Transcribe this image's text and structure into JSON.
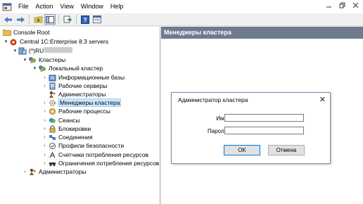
{
  "menu": {
    "items": [
      "File",
      "Action",
      "View",
      "Window",
      "Help"
    ],
    "window_controls": [
      "minimize-icon",
      "restore-icon",
      "close-icon"
    ]
  },
  "toolbar": {
    "buttons": [
      "back-arrow-icon",
      "forward-arrow-icon",
      "up-folder-icon",
      "show-hide-tree-icon",
      "export-list-icon",
      "help-icon",
      "properties-icon"
    ]
  },
  "tree": {
    "root": "Console Root",
    "server": "Central 1C:Enterprise 8.3 servers",
    "host": "(*)RU",
    "clusters": "Кластеры",
    "local_cluster": "Локальный кластер",
    "items": [
      "Информационные базы",
      "Рабочие серверы",
      "Администраторы",
      "Менеджеры кластера",
      "Рабочие процессы",
      "Сеансы",
      "Блокировки",
      "Соединения",
      "Профили безопасности",
      "Счетчики потребления ресурсов",
      "Ограничения потребления ресурсов"
    ],
    "admins": "Администраторы"
  },
  "right_pane": {
    "header": "Менеджеры кластера"
  },
  "dialog": {
    "title": "Администратор кластера",
    "name_label": "Имя:",
    "name_value": "",
    "password_label": "Пароль:",
    "password_value": "",
    "ok_label": "OK",
    "cancel_label": "Отмена"
  },
  "colors": {
    "header_bg": "#6d7b8d",
    "selection_bg": "#cce8ff",
    "default_button_border": "#0078d7"
  }
}
